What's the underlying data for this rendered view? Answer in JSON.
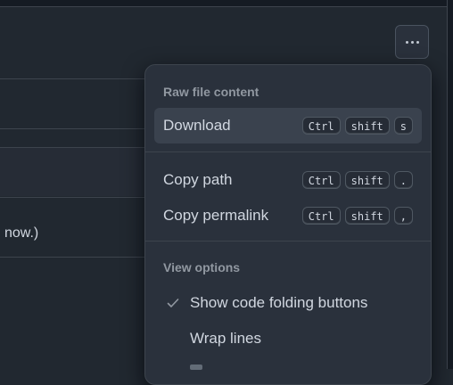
{
  "background": {
    "partial_text": "now.)"
  },
  "kebab_button": {
    "icon": "kebab-horizontal-icon"
  },
  "menu": {
    "raw_header": "Raw file content",
    "download": {
      "label": "Download",
      "keys": [
        "Ctrl",
        "shift",
        "s"
      ]
    },
    "copy_path": {
      "label": "Copy path",
      "keys": [
        "Ctrl",
        "shift",
        "."
      ]
    },
    "copy_permalink": {
      "label": "Copy permalink",
      "keys": [
        "Ctrl",
        "shift",
        ","
      ]
    },
    "view_header": "View options",
    "show_folding": {
      "label": "Show code folding buttons",
      "checked": true,
      "icon": "check-icon"
    },
    "wrap_lines": {
      "label": "Wrap lines",
      "checked": false
    }
  },
  "colors": {
    "page_bg": "#212830",
    "menu_bg": "#2a313c",
    "active_item_bg": "#3a424e",
    "border": "#3d444d",
    "text": "#d1d7e0",
    "muted_text": "#9198a1"
  }
}
